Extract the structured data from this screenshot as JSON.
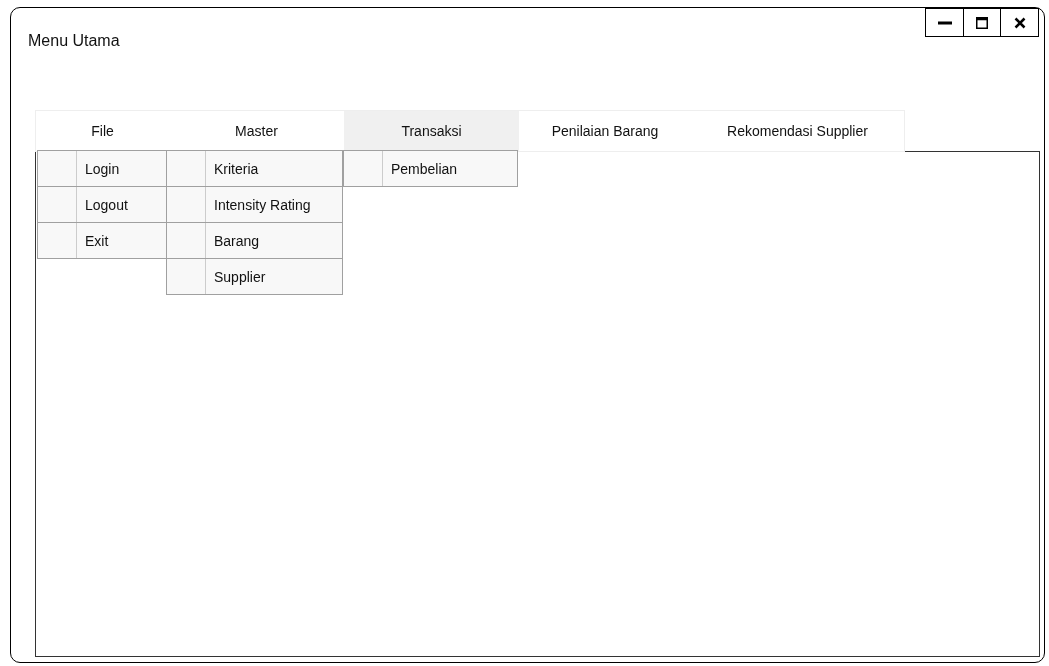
{
  "window": {
    "title": "Menu Utama",
    "controls": [
      {
        "kind": "minimize"
      },
      {
        "kind": "maximize"
      },
      {
        "kind": "close"
      }
    ]
  },
  "menus": [
    {
      "label": "File",
      "selected": false,
      "items": [
        "Login",
        "Logout",
        "Exit"
      ]
    },
    {
      "label": "Master",
      "selected": false,
      "items": [
        "Kriteria",
        "Intensity Rating",
        "Barang",
        "Supplier"
      ]
    },
    {
      "label": "Transaksi",
      "selected": true,
      "items": [
        "Pembelian"
      ]
    },
    {
      "label": "Penilaian Barang",
      "selected": false
    },
    {
      "label": "Rekomendasi Supplier",
      "selected": false
    }
  ]
}
